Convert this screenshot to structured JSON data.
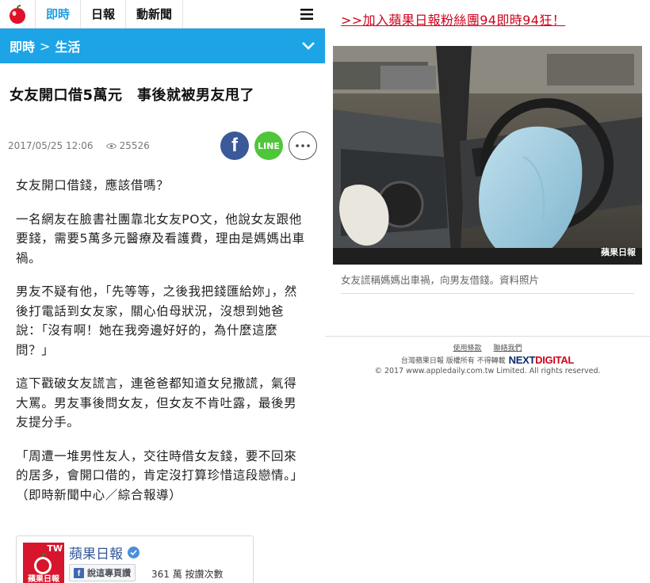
{
  "nav": {
    "tabs": [
      "即時",
      "日報",
      "動新聞"
    ]
  },
  "breadcrumb": {
    "section": "即時",
    "separator": ">",
    "subsection": "生活"
  },
  "article": {
    "headline": "女友開口借5萬元　事後就被男友甩了",
    "datetime": "2017/05/25 12:06",
    "views": "25526",
    "share_line_label": "LINE",
    "paragraphs": [
      "女友開口借錢，應該借嗎？",
      "一名網友在臉書社團靠北女友PO文，他說女友跟他要錢，需要5萬多元醫療及看護費，理由是媽媽出車禍。",
      "男友不疑有他，「先等等，之後我把錢匯給妳」，然後打電話到女友家，關心伯母狀況，沒想到她爸說：「沒有啊！她在我旁邊好好的，為什麼這麼問？」",
      "這下戳破女友謊言，連爸爸都知道女兒撒謊，氣得大罵。男友事後問女友，但女友不肯吐露，最後男友提分手。",
      "「周遭一堆男性友人，交往時借女友錢，要不回來的居多，會開口借的，肯定沒打算珍惜這段戀情。」（即時新聞中心／綜合報導）"
    ]
  },
  "fb_widget": {
    "page_name": "蘋果日報",
    "avatar_badge": "TW",
    "avatar_caption": "蘋果日報",
    "like_button": "說這專頁讚",
    "like_count": "361 萬 按讚次數"
  },
  "sidebar": {
    "promo_link": ">>加入蘋果日報粉絲團94即時94狂！",
    "photo_watermark": "蘋果日報",
    "photo_caption": "女友謊稱媽媽出車禍，向男友借錢。資料照片"
  },
  "footer": {
    "links": [
      "使用條款",
      "聯絡我們"
    ],
    "brand_text": "台灣蘋果日報 版權所有 不得轉載",
    "brand_logo_a": "NEXT",
    "brand_logo_b": "DIGITAL",
    "copyright": "© 2017 www.appledaily.com.tw Limited. All rights reserved."
  },
  "colors": {
    "accent_blue": "#1da4e6",
    "brand_red": "#d0021b",
    "facebook": "#3b5998",
    "line_green": "#4fc639"
  }
}
